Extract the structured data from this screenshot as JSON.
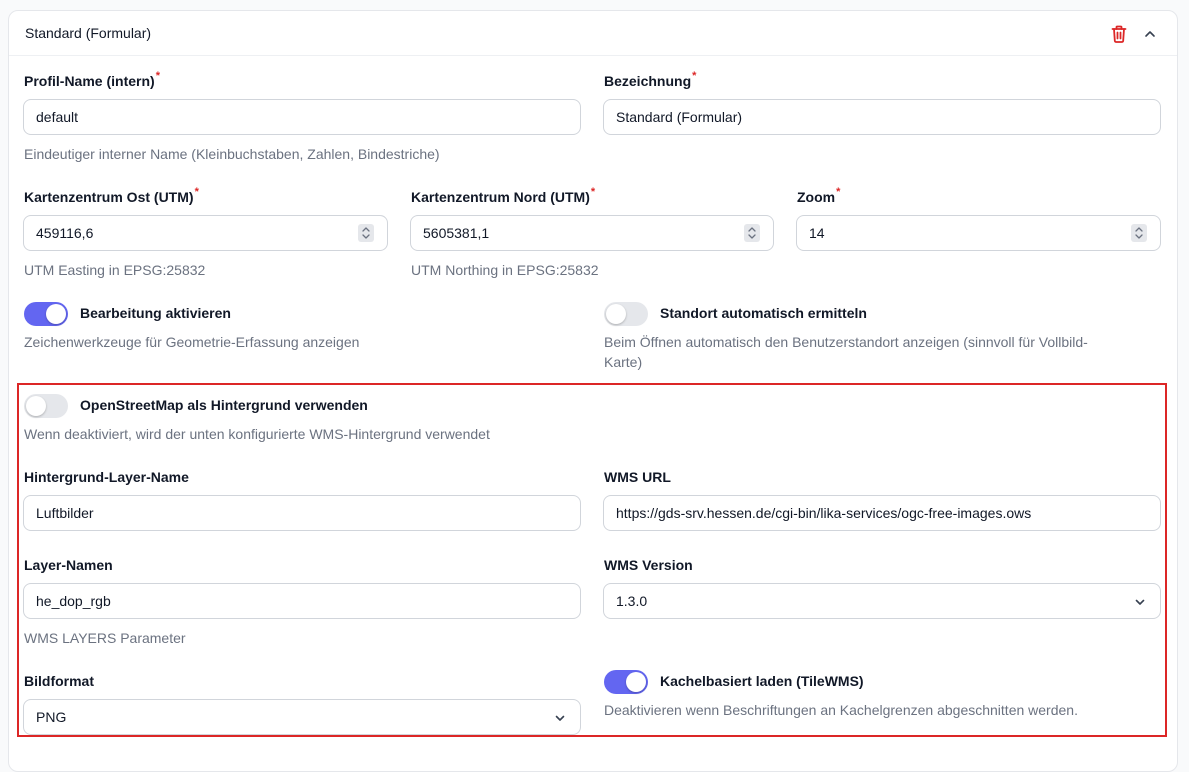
{
  "header": {
    "title": "Standard (Formular)"
  },
  "fields": {
    "profile_name": {
      "label": "Profil-Name (intern)",
      "required": "*",
      "value": "default",
      "help": "Eindeutiger interner Name (Kleinbuchstaben, Zahlen, Bindestriche)"
    },
    "bezeichnung": {
      "label": "Bezeichnung",
      "required": "*",
      "value": "Standard (Formular)"
    },
    "center_east": {
      "label": "Kartenzentrum Ost (UTM)",
      "required": "*",
      "value": "459116,6",
      "help": "UTM Easting in EPSG:25832"
    },
    "center_north": {
      "label": "Kartenzentrum Nord (UTM)",
      "required": "*",
      "value": "5605381,1",
      "help": "UTM Northing in EPSG:25832"
    },
    "zoom": {
      "label": "Zoom",
      "required": "*",
      "value": "14"
    },
    "bg_layer_name": {
      "label": "Hintergrund-Layer-Name",
      "value": "Luftbilder"
    },
    "wms_url": {
      "label": "WMS URL",
      "value": "https://gds-srv.hessen.de/cgi-bin/lika-services/ogc-free-images.ows"
    },
    "layer_names": {
      "label": "Layer-Namen",
      "value": "he_dop_rgb",
      "help": "WMS LAYERS Parameter"
    },
    "wms_version": {
      "label": "WMS Version",
      "value": "1.3.0"
    },
    "image_format": {
      "label": "Bildformat",
      "value": "PNG"
    }
  },
  "toggles": {
    "edit": {
      "label": "Bearbeitung aktivieren",
      "help": "Zeichenwerkzeuge für Geometrie-Erfassung anzeigen",
      "state": "on"
    },
    "location": {
      "label": "Standort automatisch ermitteln",
      "help_line1": "Beim Öffnen automatisch den Benutzerstandort anzeigen (sinnvoll für Vollbild-",
      "help_line2": "Karte)",
      "state": "off"
    },
    "osm": {
      "label": "OpenStreetMap als Hintergrund verwenden",
      "help": "Wenn deaktiviert, wird der unten konfigurierte WMS-Hintergrund verwendet",
      "state": "off"
    },
    "tilewms": {
      "label": "Kachelbasiert laden (TileWMS)",
      "help": "Deaktivieren wenn Beschriftungen an Kachelgrenzen abgeschnitten werden.",
      "state": "on"
    }
  },
  "colors": {
    "accent": "#6366f1",
    "danger": "#dc2626",
    "highlight_border": "#dc2626"
  },
  "icons": {
    "delete": "trash-icon",
    "collapse": "chevron-up-icon",
    "stepper": "chevron-up-down-icon",
    "select": "chevron-down-icon"
  }
}
